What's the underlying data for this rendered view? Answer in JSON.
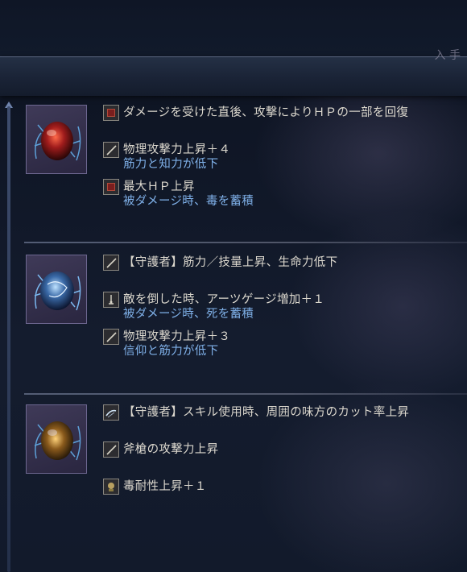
{
  "header": {
    "partial_text": "入 手"
  },
  "relics": [
    {
      "name": "relic-1",
      "gem_color": "#b8322a",
      "effects": [
        {
          "icon": "hp-recovery-icon",
          "text": "ダメージを受けた直後、攻撃によりＨＰの一部を回復",
          "sub": ""
        },
        {
          "icon": "sword-icon",
          "text": "物理攻撃力上昇＋４",
          "sub": "筋力と知力が低下"
        },
        {
          "icon": "hp-recovery-icon",
          "text": "最大ＨＰ上昇",
          "sub": "被ダメージ時、毒を蓄積"
        }
      ]
    },
    {
      "name": "relic-2",
      "gem_color": "#4a7fc0",
      "effects": [
        {
          "icon": "sword-icon",
          "text": "【守護者】筋力／技量上昇、生命力低下",
          "sub": ""
        },
        {
          "icon": "arts-icon",
          "text": "敵を倒した時、アーツゲージ増加＋１",
          "sub": "被ダメージ時、死を蓄積"
        },
        {
          "icon": "sword-icon",
          "text": "物理攻撃力上昇＋３",
          "sub": "信仰と筋力が低下"
        }
      ]
    },
    {
      "name": "relic-3",
      "gem_color": "#c08a2a",
      "effects": [
        {
          "icon": "skill-icon",
          "text": "【守護者】スキル使用時、周囲の味方のカット率上昇",
          "sub": ""
        },
        {
          "icon": "sword-icon",
          "text": "斧槍の攻撃力上昇",
          "sub": ""
        },
        {
          "icon": "poison-resist-icon",
          "text": "毒耐性上昇＋１",
          "sub": ""
        }
      ]
    }
  ]
}
